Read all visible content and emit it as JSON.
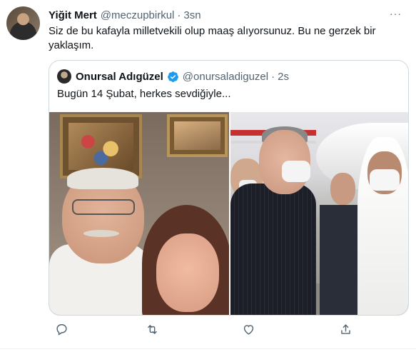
{
  "tweet": {
    "author_name": "Yiğit Mert",
    "author_handle": "@meczupbirkul",
    "separator": "·",
    "time": "3sn",
    "more": "···",
    "text": "Siz de bu kafayla milletvekili olup maaş alıyorsunuz. Bu ne gerzek bir yaklaşım."
  },
  "quote": {
    "author_name": "Onursal Adıgüzel",
    "author_handle": "@onursaladiguzel",
    "separator": "·",
    "time": "2s",
    "text": "Bugün 14 Şubat, herkes sevdiğiyle..."
  },
  "colors": {
    "text_primary": "#0f1419",
    "text_secondary": "#536471",
    "verified_blue": "#1d9bf0",
    "border": "#cfd9de"
  },
  "icons": [
    "reply-icon",
    "retweet-icon",
    "like-icon",
    "share-icon",
    "verified-badge-icon",
    "more-icon"
  ]
}
